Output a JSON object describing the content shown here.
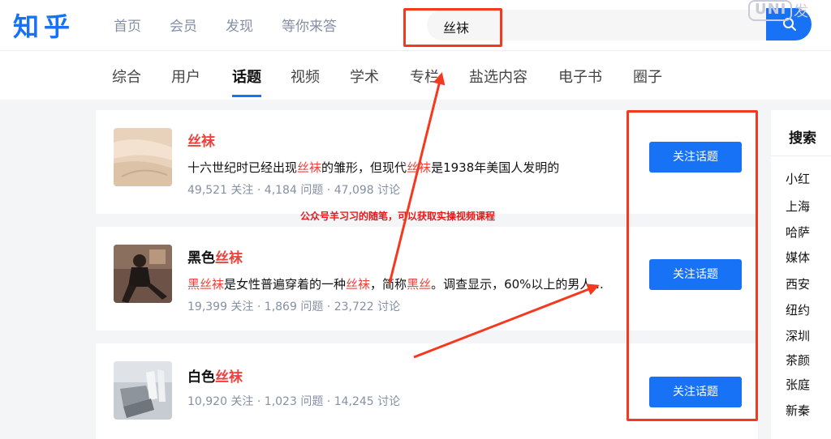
{
  "header": {
    "logo": "知乎",
    "nav": [
      "首页",
      "会员",
      "发现",
      "等你来答"
    ],
    "search_value": "丝袜",
    "watermark": "发"
  },
  "tabs": [
    "综合",
    "用户",
    "话题",
    "视频",
    "学术",
    "专栏",
    "盐选内容",
    "电子书",
    "圈子"
  ],
  "active_tab": "话题",
  "results": [
    {
      "title_plain": "",
      "title_hl": "丝袜",
      "desc_parts": [
        {
          "t": "十六世纪时已经出现",
          "hl": false
        },
        {
          "t": "丝袜",
          "hl": true
        },
        {
          "t": "的雏形，但现代",
          "hl": false
        },
        {
          "t": "丝袜",
          "hl": true
        },
        {
          "t": "是1938年美国人发明的",
          "hl": false
        }
      ],
      "followers": "49,521 关注",
      "questions": "4,184 问题",
      "discussions": "47,098 讨论",
      "button": "关注话题"
    },
    {
      "title_plain": "黑色",
      "title_hl": "丝袜",
      "desc_parts": [
        {
          "t": "黑丝袜",
          "hl": true
        },
        {
          "t": "是女性普遍穿着的一种",
          "hl": false
        },
        {
          "t": "丝袜",
          "hl": true
        },
        {
          "t": "，简称",
          "hl": false
        },
        {
          "t": "黑丝",
          "hl": true
        },
        {
          "t": "。调查显示，60%以上的男人...",
          "hl": false
        }
      ],
      "followers": "19,399 关注",
      "questions": "1,869 问题",
      "discussions": "23,722 讨论",
      "button": "关注话题"
    },
    {
      "title_plain": "白色",
      "title_hl": "丝袜",
      "desc_parts": [],
      "followers": "10,920 关注",
      "questions": "1,023 问题",
      "discussions": "14,245 讨论",
      "button": "关注话题"
    }
  ],
  "stat_separator": "·",
  "sidebar": {
    "title": "搜索",
    "items": [
      "小红",
      "上海",
      "哈萨",
      "媒体",
      "西安",
      "纽约",
      "深圳",
      "茶颜",
      "张庭",
      "新秦"
    ]
  },
  "annotation_text": "公众号羊习习的随笔，可以获取实操视频课程",
  "colors": {
    "brand": "#1772f6",
    "highlight": "#f1403c",
    "annotation": "#f5391f"
  },
  "icons": {
    "search_button": "search-icon"
  }
}
